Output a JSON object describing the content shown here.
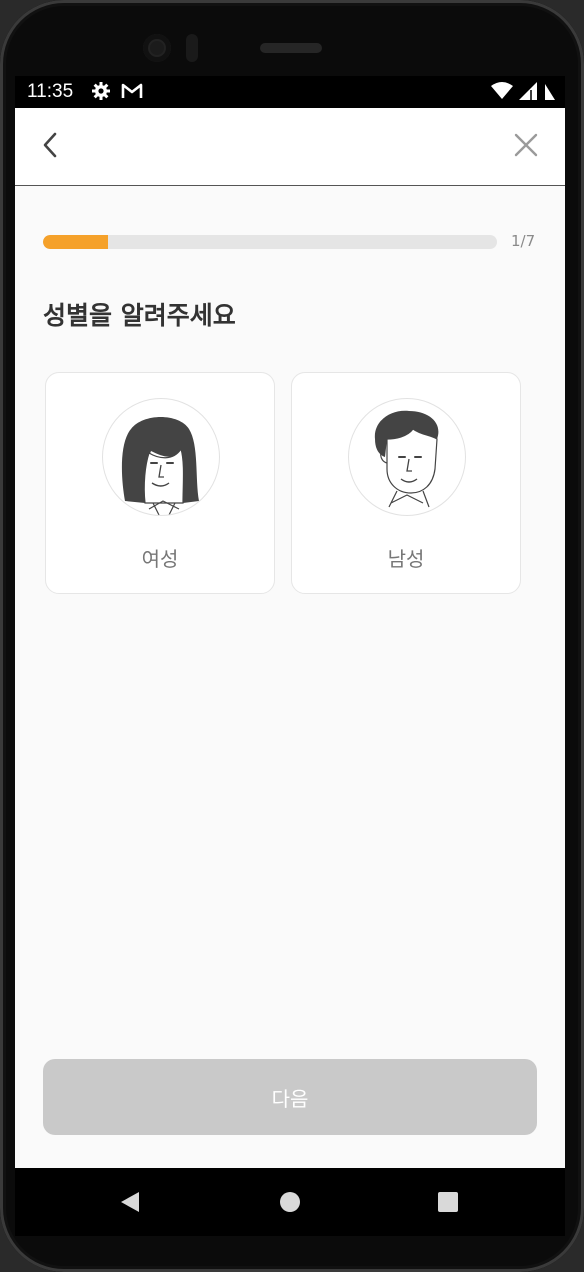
{
  "status_bar": {
    "time": "11:35",
    "left_icons": [
      "gear-icon",
      "gmail-icon"
    ],
    "right_icons": [
      "wifi-icon",
      "signal-icon",
      "battery-icon"
    ]
  },
  "app_bar": {
    "back_icon": "chevron-left-icon",
    "close_icon": "close-icon"
  },
  "progress": {
    "label": "1/7",
    "fraction": 0.142857,
    "fill_color": "#f5a12a"
  },
  "question": "성별을 알려주세요",
  "options": [
    {
      "id": "female",
      "label": "여성",
      "icon": "female-avatar-icon"
    },
    {
      "id": "male",
      "label": "남성",
      "icon": "male-avatar-icon"
    }
  ],
  "next_button": {
    "label": "다음",
    "background": "#c9c9c9",
    "disabled": true
  },
  "nav_bar": {
    "icons": [
      "back-triangle-icon",
      "home-circle-icon",
      "recents-square-icon"
    ]
  }
}
